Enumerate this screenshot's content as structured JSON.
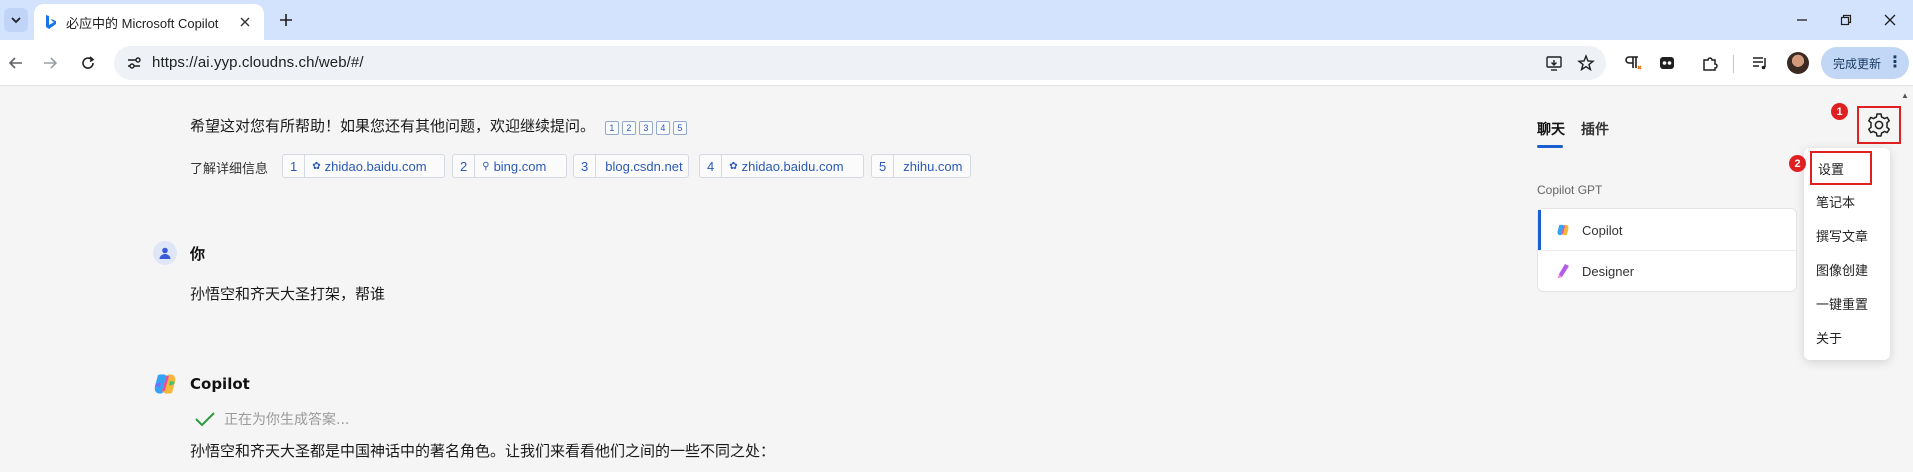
{
  "browser": {
    "tab_title": "必应中的 Microsoft Copilot",
    "url": "https://ai.yyp.cloudns.ch/web/#/",
    "update_label": "完成更新"
  },
  "conversation": {
    "prev_answer_tail": "希望这对您有所帮助！如果您还有其他问题，欢迎继续提问。",
    "citation_marks": [
      "1",
      "2",
      "3",
      "4",
      "5"
    ],
    "learn_more_label": "了解详细信息",
    "sources": [
      {
        "num": "1",
        "icon": "baidu-icon",
        "name": "zhidao.baidu.com"
      },
      {
        "num": "2",
        "icon": "search-icon",
        "name": "bing.com"
      },
      {
        "num": "3",
        "icon": "",
        "name": "blog.csdn.net"
      },
      {
        "num": "4",
        "icon": "baidu-icon",
        "name": "zhidao.baidu.com"
      },
      {
        "num": "5",
        "icon": "",
        "name": "zhihu.com"
      }
    ],
    "user_name": "你",
    "user_message": "孙悟空和齐天大圣打架，帮谁",
    "bot_name": "Copilot",
    "generating_status": "正在为你生成答案...",
    "bot_answer_start": "孙悟空和齐天大圣都是中国神话中的著名角色。让我们来看看他们之间的一些不同之处："
  },
  "side_panel": {
    "tabs": [
      "聊天",
      "插件"
    ],
    "section_label": "Copilot GPT",
    "gpts": [
      {
        "name": "Copilot",
        "icon": "copilot-icon",
        "active": true
      },
      {
        "name": "Designer",
        "icon": "designer-icon",
        "active": false
      }
    ]
  },
  "settings_menu": {
    "items": [
      "设置",
      "笔记本",
      "撰写文章",
      "图像创建",
      "一键重置",
      "关于"
    ]
  },
  "annotations": {
    "badge_1": "1",
    "badge_2": "2",
    "highlight_color": "#e02020"
  },
  "colors": {
    "accent": "#1a5fd0",
    "tabbar_bg": "#d3e3fd",
    "page_bg": "#f5f5f5",
    "link": "#2b5ab5"
  }
}
